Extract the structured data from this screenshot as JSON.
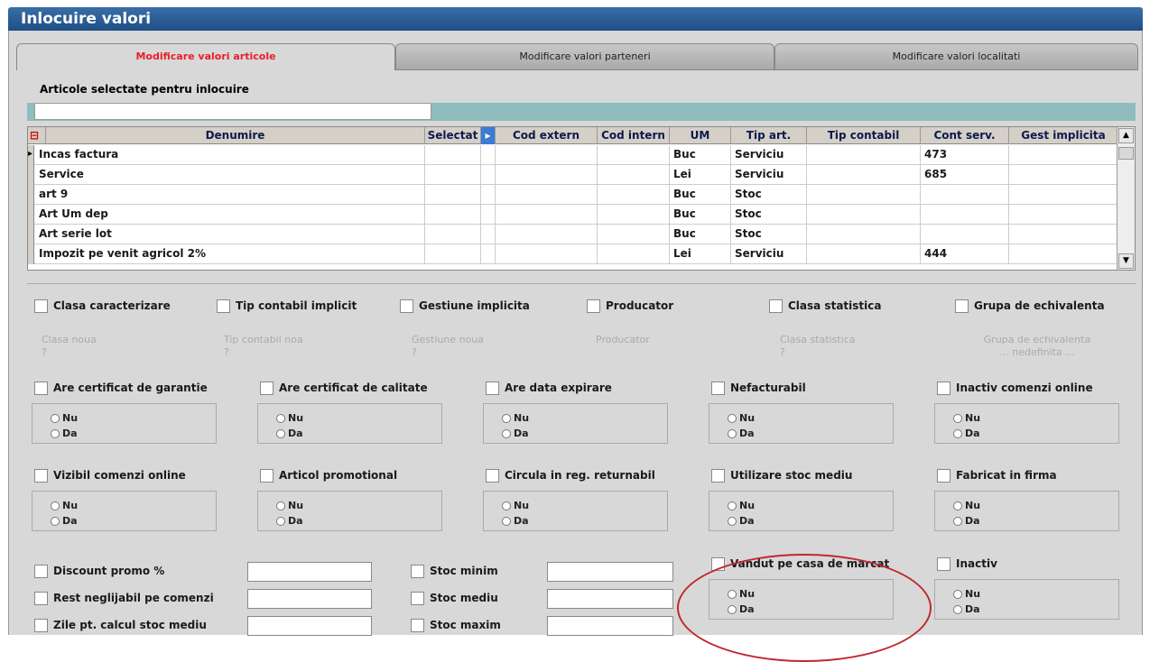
{
  "window": {
    "title": "Inlocuire valori"
  },
  "tabs": [
    {
      "label": "Modificare valori articole"
    },
    {
      "label": "Modificare valori parteneri"
    },
    {
      "label": "Modificare valori localitati"
    }
  ],
  "section": {
    "title": "Articole selectate pentru inlocuire"
  },
  "grid": {
    "columns": [
      "Denumire",
      "Selectat",
      "Cod extern",
      "Cod intern",
      "UM",
      "Tip art.",
      "Tip contabil",
      "Cont serv.",
      "Gest implicita"
    ],
    "rows": [
      {
        "denumire": "Incas factura",
        "um": "Buc",
        "tip": "Serviciu",
        "cont": "473"
      },
      {
        "denumire": "Service",
        "um": "Lei",
        "tip": "Serviciu",
        "cont": "685"
      },
      {
        "denumire": "art 9",
        "um": "Buc",
        "tip": "Stoc",
        "cont": ""
      },
      {
        "denumire": "Art Um dep",
        "um": "Buc",
        "tip": "Stoc",
        "cont": ""
      },
      {
        "denumire": "Art serie lot",
        "um": "Buc",
        "tip": "Stoc",
        "cont": ""
      },
      {
        "denumire": "Impozit pe venit agricol 2%",
        "um": "Lei",
        "tip": "Serviciu",
        "cont": "444"
      }
    ]
  },
  "row1": [
    {
      "label": "Clasa caracterizare",
      "sub1": "Clasa noua",
      "sub2": "?"
    },
    {
      "label": "Tip contabil implicit",
      "sub1": "Tip contabil noa",
      "sub2": "?"
    },
    {
      "label": "Gestiune implicita",
      "sub1": "Gestiune noua",
      "sub2": "?"
    },
    {
      "label": "Producator",
      "sub1": "Producator",
      "sub2": ""
    },
    {
      "label": "Clasa statistica",
      "sub1": "Clasa statistica",
      "sub2": "?"
    },
    {
      "label": "Grupa de echivalenta",
      "sub1": "Grupa de echivalenta",
      "sub2": "... nedefinita ..."
    }
  ],
  "row2": [
    "Are certificat de garantie",
    "Are certificat de calitate",
    "Are data expirare",
    "Nefacturabil",
    "Inactiv comenzi online"
  ],
  "row3": [
    "Vizibil comenzi online",
    "Articol promotional",
    "Circula in reg. returnabil",
    "Utilizare stoc mediu",
    "Fabricat in firma"
  ],
  "radio": {
    "nu": "Nu",
    "da": "Da"
  },
  "row4_left": [
    "Discount promo %",
    "Rest neglijabil pe comenzi",
    "Zile pt. calcul stoc mediu"
  ],
  "row4_mid": [
    "Stoc minim",
    "Stoc mediu",
    "Stoc maxim"
  ],
  "row4_right": [
    "Vandut pe casa de marcat",
    "Inactiv"
  ]
}
